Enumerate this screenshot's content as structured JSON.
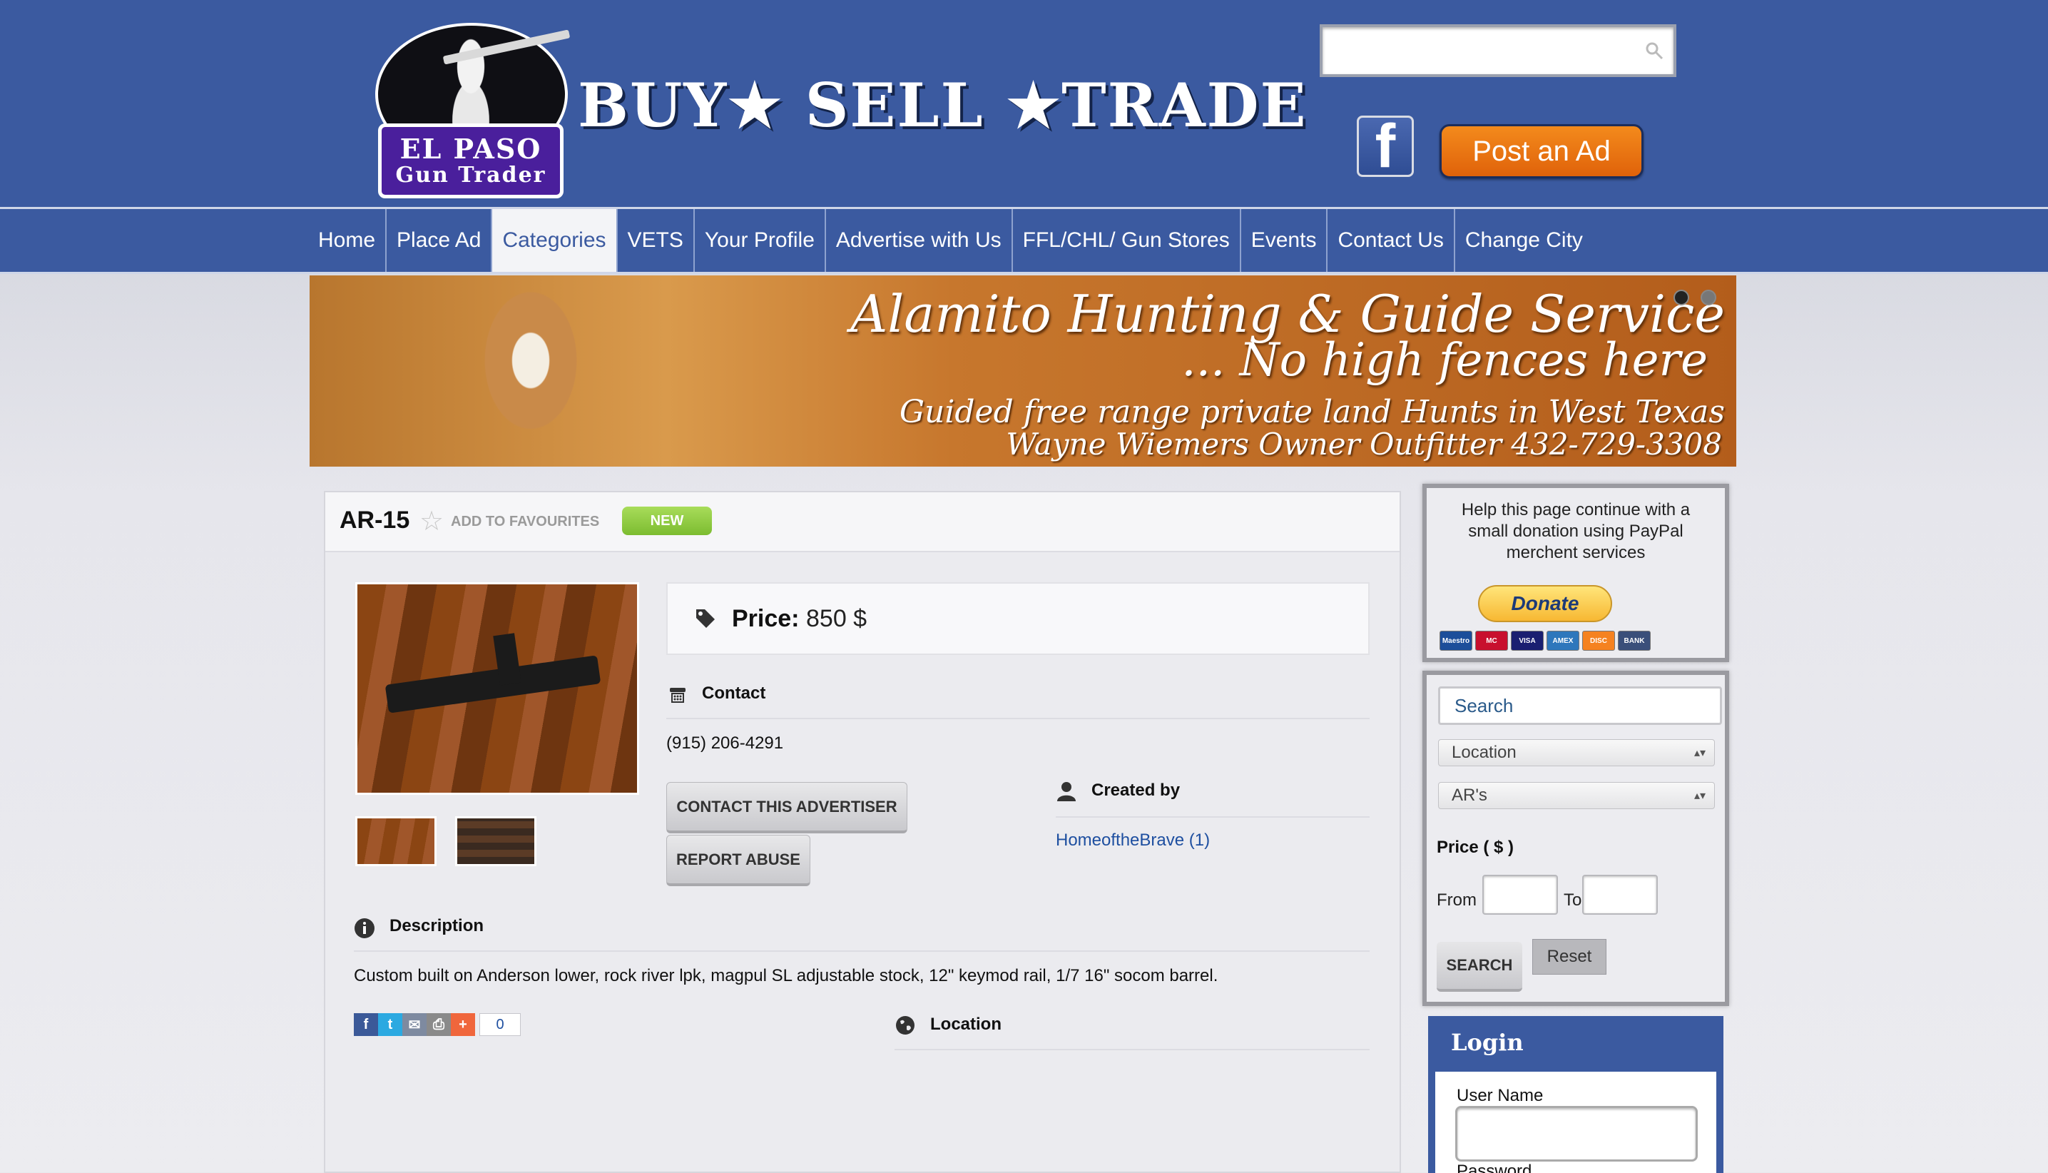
{
  "brand": {
    "logo_line1": "EL PASO",
    "logo_line2": "Gun Trader",
    "tagline": "BUY★ SELL ★TRADE"
  },
  "header": {
    "search_placeholder": "",
    "facebook_icon": "f",
    "post_ad_label": "Post an Ad"
  },
  "nav": {
    "items": [
      {
        "label": "Home"
      },
      {
        "label": "Place Ad"
      },
      {
        "label": "Categories",
        "active": true
      },
      {
        "label": "VETS"
      },
      {
        "label": "Your Profile"
      },
      {
        "label": "Advertise with Us"
      },
      {
        "label": "FFL/CHL/ Gun Stores"
      },
      {
        "label": "Events"
      },
      {
        "label": "Contact Us"
      },
      {
        "label": "Change City"
      }
    ]
  },
  "banner": {
    "line1": "Alamito Hunting & Guide Service",
    "line2": "... No high fences here",
    "line3": "Guided free range private land Hunts in West Texas",
    "line4": "Wayne Wiemers Owner Outfitter 432-729-3308"
  },
  "listing": {
    "title": "AR-15",
    "add_favourites": "ADD TO FAVOURITES",
    "badge": "NEW",
    "price_label": "Price:",
    "price_value": "850 $",
    "contact_header": "Contact",
    "phone": "(915) 206-4291",
    "contact_button": "CONTACT THIS ADVERTISER",
    "report_button": "REPORT ABUSE",
    "created_by_header": "Created by",
    "created_by_user": "HomeoftheBrave (1)",
    "description_header": "Description",
    "description": "Custom built on Anderson lower, rock river lpk, magpul SL adjustable stock, 12\" keymod rail, 1/7 16\" socom barrel.",
    "location_header": "Location",
    "share_count": "0"
  },
  "sidebar": {
    "donate_message": "Help this page continue with a small donation using PayPal merchent services",
    "donate_button": "Donate",
    "cards": [
      "Maestro",
      "MC",
      "VISA",
      "AMEX",
      "DISC",
      "BANK"
    ],
    "search_placeholder": "Search",
    "location_select": "Location",
    "category_select": "AR's",
    "price_label": "Price ( $ )",
    "from_label": "From",
    "to_label": "To",
    "search_button": "SEARCH",
    "reset_button": "Reset",
    "login_header": "Login",
    "username_label": "User Name",
    "password_label": "Password"
  },
  "colors": {
    "header_blue": "#3b5aa0",
    "post_ad_orange": "#f07c15",
    "badge_green": "#8cc63f",
    "link_blue": "#1e4fa0"
  }
}
